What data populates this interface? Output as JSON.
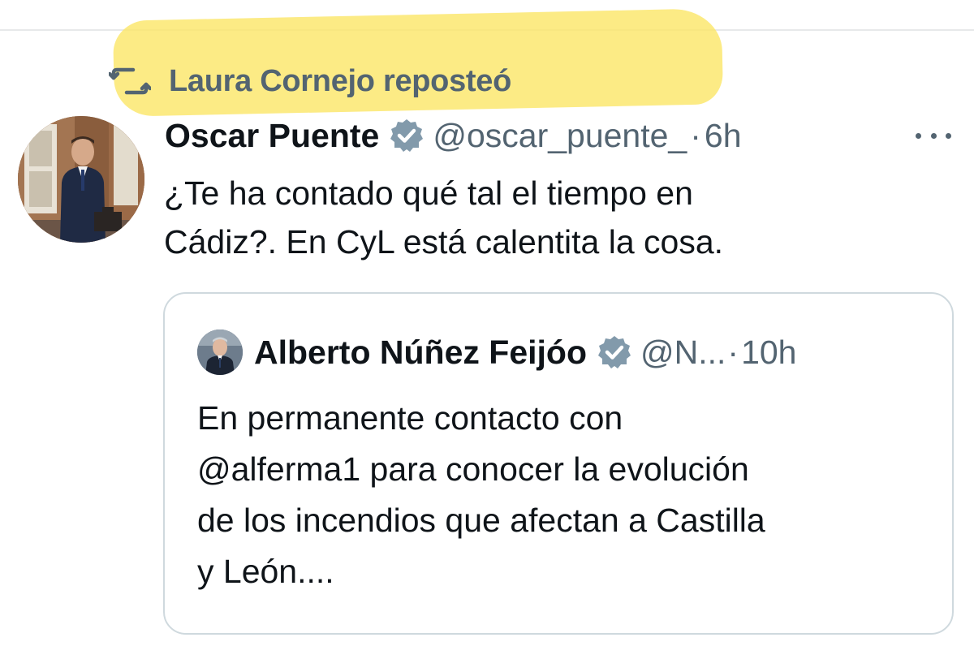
{
  "repost": {
    "text": "Laura Cornejo reposteó",
    "icon": "repost-icon"
  },
  "tweet": {
    "author_name": "Oscar Puente",
    "verified_icon": "verified-badge-icon",
    "handle": "@oscar_puente_",
    "separator": "·",
    "time": "6h",
    "more_icon": "more-options-icon",
    "text": "¿Te ha contado qué tal el tiempo en\nCádiz?. En CyL está calentita la cosa."
  },
  "quoted_tweet": {
    "author_name": "Alberto Núñez Feijóo",
    "verified_icon": "verified-badge-icon",
    "handle": "@N...",
    "separator": "·",
    "time": "10h",
    "text": "En permanente contacto con\n@alferma1 para conocer la evolución\nde los incendios que afectan a Castilla\ny León...."
  },
  "colors": {
    "highlight": "#fbe76a",
    "secondary_text": "#536471",
    "primary_text": "#0f1419",
    "card_border": "#cfd9de"
  }
}
